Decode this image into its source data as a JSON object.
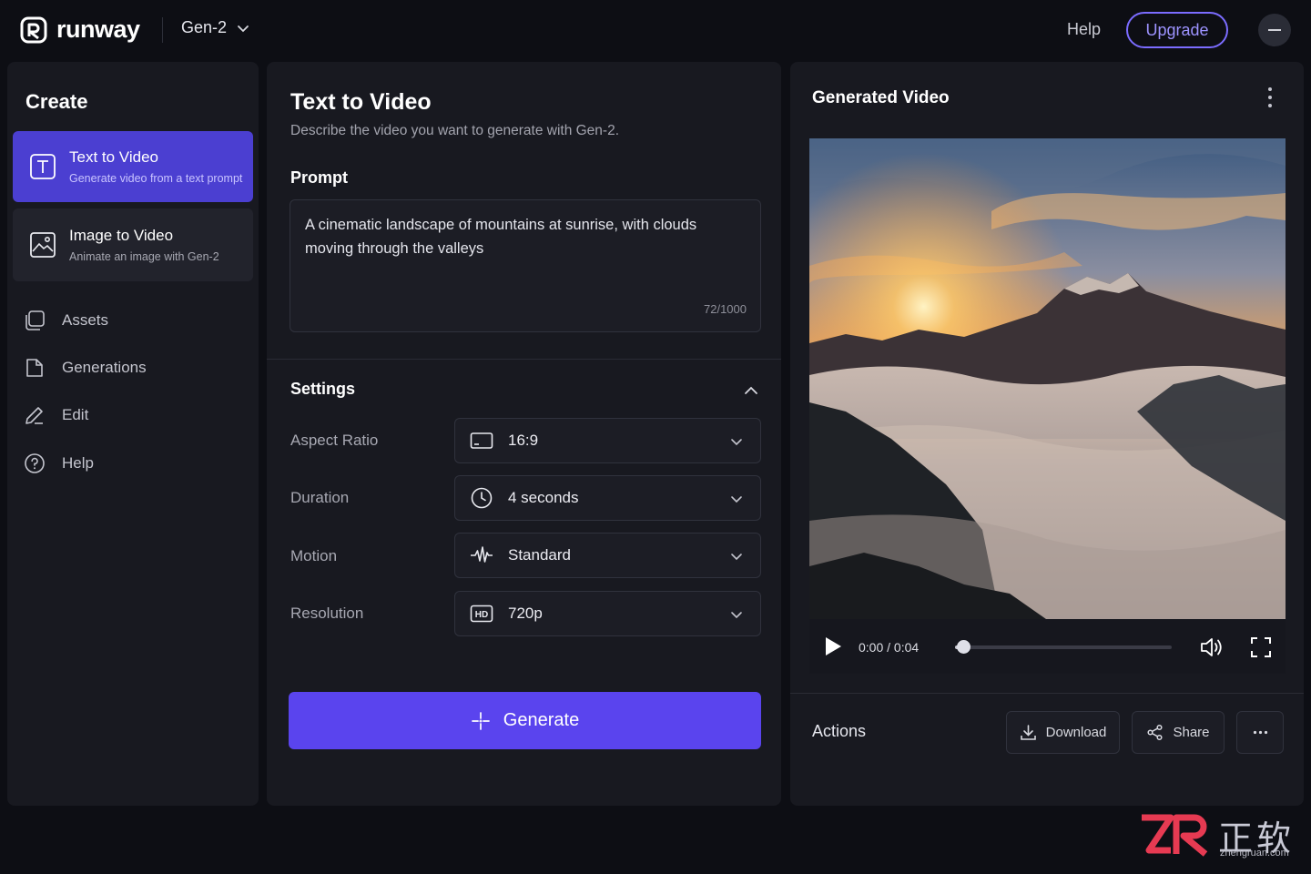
{
  "app": {
    "logo_text": "runway",
    "model_selector": "Gen-2",
    "help_label": "Help",
    "upgrade_label": "Upgrade"
  },
  "sidebar": {
    "title": "Create",
    "create_options": [
      {
        "title": "Text to Video",
        "subtitle": "Generate video from a text prompt",
        "icon": "text-box-icon",
        "active": true
      },
      {
        "title": "Image to Video",
        "subtitle": "Animate an image with Gen-2",
        "icon": "image-icon",
        "active": false
      }
    ],
    "nav": [
      {
        "label": "Assets",
        "icon": "assets-icon"
      },
      {
        "label": "Generations",
        "icon": "generations-icon"
      },
      {
        "label": "Edit",
        "icon": "pencil-icon"
      },
      {
        "label": "Help",
        "icon": "question-circle-icon"
      }
    ]
  },
  "main": {
    "title": "Text to Video",
    "subtitle": "Describe the video you want to generate with Gen-2.",
    "prompt_label": "Prompt",
    "prompt_value": "A cinematic landscape of mountains at sunrise, with clouds moving through the valleys",
    "char_count": "72/1000",
    "settings_label": "Settings",
    "settings": [
      {
        "label": "Aspect Ratio",
        "value": "16:9",
        "icon": "aspect-ratio-icon"
      },
      {
        "label": "Duration",
        "value": "4 seconds",
        "icon": "clock-icon"
      },
      {
        "label": "Motion",
        "value": "Standard",
        "icon": "waveform-icon"
      },
      {
        "label": "Resolution",
        "value": "720p",
        "icon": "hd-icon"
      }
    ],
    "generate_label": "Generate"
  },
  "output": {
    "title": "Generated Video",
    "timecode": "0:00 / 0:04",
    "progress": 0.04,
    "actions_label": "Actions",
    "download_label": "Download",
    "share_label": "Share"
  },
  "watermark": {
    "logo_text": "ZR",
    "name_cn": "正软",
    "url": "zhengruan.com"
  },
  "colors": {
    "accent": "#5a44ee",
    "accent_active_card": "#4b3fd1",
    "upgrade_outline": "#7b6cff",
    "background": "#0d0e14",
    "panel": "#181920"
  }
}
